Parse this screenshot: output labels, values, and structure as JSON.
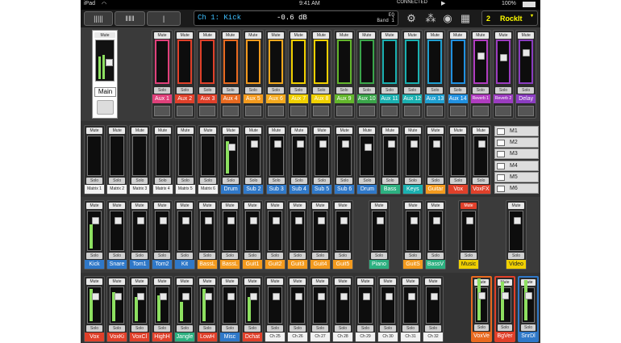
{
  "status": {
    "device": "iPad",
    "time": "9:41 AM",
    "battery": "100%"
  },
  "toolbar": {
    "display_ch": "Ch 1: Kick",
    "display_val": "-0.6 dB",
    "display_eq": "EQ",
    "display_band": "Band 1",
    "connected": "CONNECTED",
    "snapshot_num": "2",
    "snapshot_name": "RockIt"
  },
  "labels": {
    "mute": "Mute",
    "solo": "Solo"
  },
  "main": {
    "label": "Main"
  },
  "aux_row": [
    {
      "label": "Aux 1",
      "color": "#e0407a"
    },
    {
      "label": "Aux 2",
      "color": "#e0402a"
    },
    {
      "label": "Aux 3",
      "color": "#e0402a"
    },
    {
      "label": "Aux 4",
      "color": "#e86a20"
    },
    {
      "label": "Aux 5",
      "color": "#f39a1e"
    },
    {
      "label": "Aux 6",
      "color": "#f3a91e"
    },
    {
      "label": "Aux 7",
      "color": "#f0d000"
    },
    {
      "label": "Aux 8",
      "color": "#f0d000"
    },
    {
      "label": "Aux 9",
      "color": "#63b62c"
    },
    {
      "label": "Aux 10",
      "color": "#3aa54a"
    },
    {
      "label": "Aux 11",
      "color": "#1ab0b0"
    },
    {
      "label": "Aux 12",
      "color": "#1ab0b0"
    },
    {
      "label": "Aux 13",
      "color": "#1f9fd0"
    },
    {
      "label": "Aux 14",
      "color": "#2090e0"
    },
    {
      "label": "Reverb 1",
      "color": "#b03cc0"
    },
    {
      "label": "Reverb 2",
      "color": "#9b3cc0"
    },
    {
      "label": "Delay",
      "color": "#8a3cc0"
    }
  ],
  "matrix_row": [
    {
      "label": "Matrix 1",
      "color": ""
    },
    {
      "label": "Matrix 2",
      "color": ""
    },
    {
      "label": "Matrix 3",
      "color": ""
    },
    {
      "label": "Matrix 4",
      "color": ""
    },
    {
      "label": "Matrix 5",
      "color": ""
    },
    {
      "label": "Matrix 6",
      "color": ""
    },
    {
      "label": "Drum",
      "color": "#2f78c8"
    },
    {
      "label": "Sub 2",
      "color": "#2f78c8"
    },
    {
      "label": "Sub 3",
      "color": "#2f78c8"
    },
    {
      "label": "Sub 4",
      "color": "#2f78c8"
    },
    {
      "label": "Sub 5",
      "color": "#2f78c8"
    },
    {
      "label": "Sub 6",
      "color": "#2f78c8"
    },
    {
      "label": "Drum",
      "color": "#2f78c8"
    },
    {
      "label": "Bass",
      "color": "#2cb080"
    },
    {
      "label": "Keys",
      "color": "#1ab0b0"
    },
    {
      "label": "Guitar",
      "color": "#f39a1e"
    },
    {
      "label": "Vox",
      "color": "#e0402a"
    },
    {
      "label": "VoxFX",
      "color": "#e0402a"
    }
  ],
  "mutegroups": [
    "M1",
    "M2",
    "M3",
    "M4",
    "M5",
    "M6"
  ],
  "row3": [
    {
      "label": "Kick",
      "color": "#2f78c8"
    },
    {
      "label": "Snare",
      "color": "#2f78c8"
    },
    {
      "label": "Tom1",
      "color": "#2f78c8"
    },
    {
      "label": "Tom2",
      "color": "#2f78c8"
    },
    {
      "label": "Kit",
      "color": "#2f78c8"
    },
    {
      "label": "BassL",
      "color": "#f39a1e"
    },
    {
      "label": "BassL",
      "color": "#f39a1e"
    },
    {
      "label": "Guit1",
      "color": "#f39a1e"
    },
    {
      "label": "Guit2",
      "color": "#f39a1e"
    },
    {
      "label": "Guit3",
      "color": "#f39a1e"
    },
    {
      "label": "Guit4",
      "color": "#f39a1e"
    },
    {
      "label": "Guit5",
      "color": "#f39a1e"
    },
    {
      "label": "Piano",
      "color": "#2cb080"
    },
    {
      "label": "GuitS",
      "color": "#f39a1e"
    },
    {
      "label": "BassV",
      "color": "#2cb080"
    },
    {
      "label": "Music",
      "color": "#f0d000"
    },
    {
      "label": "Video",
      "color": "#f0d000"
    }
  ],
  "row4": [
    {
      "label": "Vox",
      "color": "#e0402a"
    },
    {
      "label": "VoxKi",
      "color": "#e0402a"
    },
    {
      "label": "VoxCl",
      "color": "#e0402a"
    },
    {
      "label": "HighH",
      "color": "#e0402a"
    },
    {
      "label": "Jangle",
      "color": "#2cb080"
    },
    {
      "label": "LowH",
      "color": "#e0402a"
    },
    {
      "label": "Misc",
      "color": "#2f78c8"
    },
    {
      "label": "Dchat",
      "color": "#e0402a"
    },
    {
      "label": "Ch 25",
      "color": "#f2f2f2"
    },
    {
      "label": "Ch 26",
      "color": "#f2f2f2"
    },
    {
      "label": "Ch 27",
      "color": "#f2f2f2"
    },
    {
      "label": "Ch 28",
      "color": "#f2f2f2"
    },
    {
      "label": "Ch 29",
      "color": "#f2f2f2"
    },
    {
      "label": "Ch 30",
      "color": "#f2f2f2"
    },
    {
      "label": "Ch 31",
      "color": "#f2f2f2"
    },
    {
      "label": "Ch 32",
      "color": "#f2f2f2"
    },
    {
      "label": "VoxVe",
      "color": "#e86a20"
    },
    {
      "label": "BgVer",
      "color": "#e0402a"
    },
    {
      "label": "SnrDl",
      "color": "#2f78c8"
    }
  ]
}
